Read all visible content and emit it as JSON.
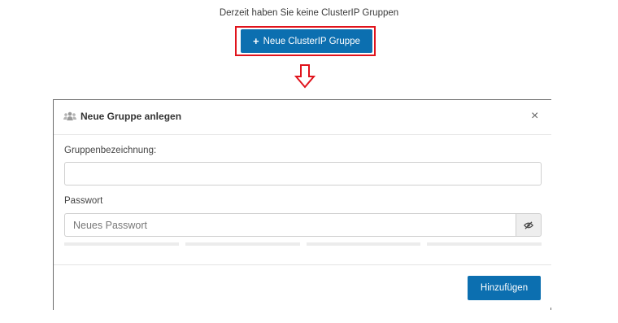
{
  "empty_state": {
    "message": "Derzeit haben Sie keine ClusterIP Gruppen",
    "new_button_label": "Neue ClusterIP Gruppe"
  },
  "annotation": {
    "highlight_color": "#e0131c",
    "arrow": "down-arrow-outline"
  },
  "modal": {
    "title": "Neue Gruppe anlegen",
    "title_icon": "group-icon",
    "close_icon": "close-icon",
    "group_name_label": "Gruppenbezeichnung:",
    "group_name_value": "",
    "password_label": "Passwort",
    "password_placeholder": "Neues Passwort",
    "password_value": "",
    "toggle_icon": "eye-slash-icon",
    "strength_segments": 4,
    "submit_label": "Hinzufügen"
  },
  "colors": {
    "primary": "#0c6fb0",
    "accent_red": "#e0131c"
  }
}
